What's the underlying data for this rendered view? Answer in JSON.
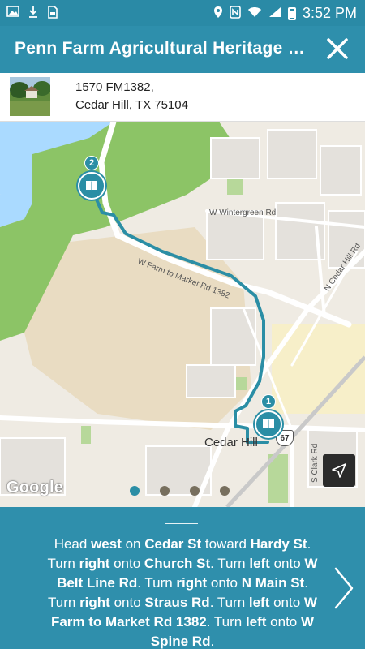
{
  "status_bar": {
    "time": "3:52 PM",
    "left_icons": [
      "image-icon",
      "download-icon",
      "sim-icon"
    ],
    "right_icons": [
      "location-icon",
      "nfc-icon",
      "wifi-icon",
      "signal-icon",
      "battery-icon"
    ]
  },
  "header": {
    "title": "Penn Farm Agricultural Heritage Center",
    "close_icon": "close-icon"
  },
  "address": {
    "line1": "1570 FM1382,",
    "line2": "Cedar Hill, TX 75104"
  },
  "map": {
    "labels": {
      "wintergreen": "W Wintergreen Rd",
      "fm1382": "W Farm to Market Rd 1382",
      "n_cedar_hill": "N Cedar Hill Rd",
      "cedar_hill": "Cedar Hill",
      "s_clark": "S Clark Rd",
      "hwy": "67"
    },
    "pins": [
      {
        "number": "2",
        "icon": "book-icon"
      },
      {
        "number": "1",
        "icon": "book-icon"
      }
    ],
    "attribution": "Google",
    "locate_icon": "navigation-arrow-icon",
    "pagination": {
      "count": 4,
      "active_index": 0
    },
    "colors": {
      "water": "#aadaff",
      "park": "#8cc466",
      "route": "#2b8ea5"
    }
  },
  "directions": {
    "segments": [
      {
        "text": "Head ",
        "bold": false
      },
      {
        "text": "west",
        "bold": true
      },
      {
        "text": " on ",
        "bold": false
      },
      {
        "text": "Cedar St",
        "bold": true
      },
      {
        "text": " toward ",
        "bold": false
      },
      {
        "text": "Hardy St",
        "bold": true
      },
      {
        "text": ". Turn ",
        "bold": false
      },
      {
        "text": "right",
        "bold": true
      },
      {
        "text": " onto ",
        "bold": false
      },
      {
        "text": "Church St",
        "bold": true
      },
      {
        "text": ". Turn ",
        "bold": false
      },
      {
        "text": "left",
        "bold": true
      },
      {
        "text": " onto ",
        "bold": false
      },
      {
        "text": "W Belt Line Rd",
        "bold": true
      },
      {
        "text": ". Turn ",
        "bold": false
      },
      {
        "text": "right",
        "bold": true
      },
      {
        "text": " onto ",
        "bold": false
      },
      {
        "text": "N Main St",
        "bold": true
      },
      {
        "text": ". Turn ",
        "bold": false
      },
      {
        "text": "right",
        "bold": true
      },
      {
        "text": " onto ",
        "bold": false
      },
      {
        "text": "Straus Rd",
        "bold": true
      },
      {
        "text": ". Turn ",
        "bold": false
      },
      {
        "text": "left",
        "bold": true
      },
      {
        "text": " onto ",
        "bold": false
      },
      {
        "text": "W Farm to Market Rd 1382",
        "bold": true
      },
      {
        "text": ". Turn ",
        "bold": false
      },
      {
        "text": "left",
        "bold": true
      },
      {
        "text": " onto ",
        "bold": false
      },
      {
        "text": "W Spine Rd",
        "bold": true
      },
      {
        "text": ".",
        "bold": false
      }
    ],
    "next_icon": "chevron-right-icon"
  },
  "theme": {
    "primary": "#2e8fac",
    "status_bar": "#2a8aa6"
  }
}
